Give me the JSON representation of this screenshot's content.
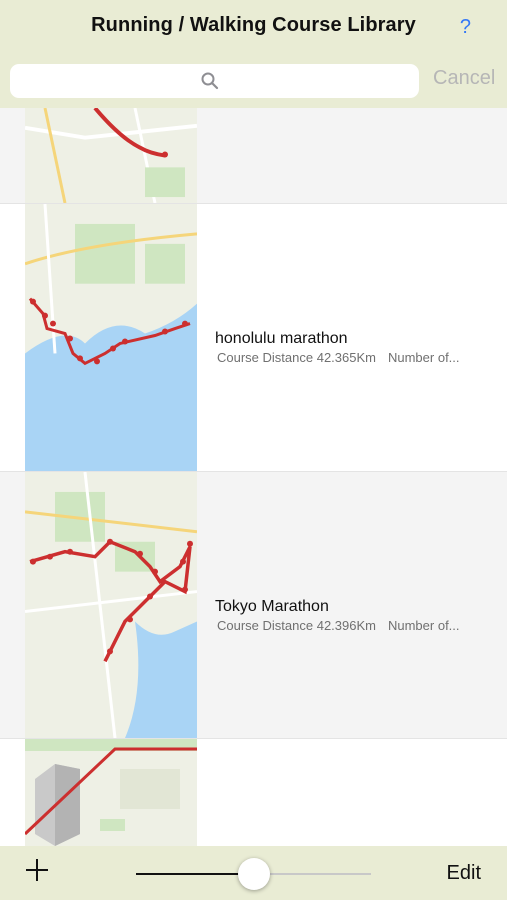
{
  "header": {
    "title": "Running / Walking Course Library",
    "help_label": "?"
  },
  "search": {
    "placeholder": "",
    "value": "",
    "cancel_label": "Cancel"
  },
  "courses": [
    {
      "name": "",
      "distance": "",
      "points": ""
    },
    {
      "name": "honolulu marathon",
      "distance": "Course Distance 42.365Km",
      "points": "Number of..."
    },
    {
      "name": "Tokyo Marathon",
      "distance": "Course Distance 42.396Km",
      "points": "Number of..."
    },
    {
      "name": "",
      "distance": "",
      "points": ""
    }
  ],
  "toolbar": {
    "add_label": "+",
    "edit_label": "Edit",
    "zoom_level": 0.5
  },
  "colors": {
    "bar_bg": "#e9ecd4",
    "route": "#cc2f2f",
    "accent": "#3478f6",
    "water": "#a9d4f5",
    "land": "#eef0e5"
  },
  "icons": [
    "search-icon",
    "plus-icon",
    "help-icon"
  ]
}
